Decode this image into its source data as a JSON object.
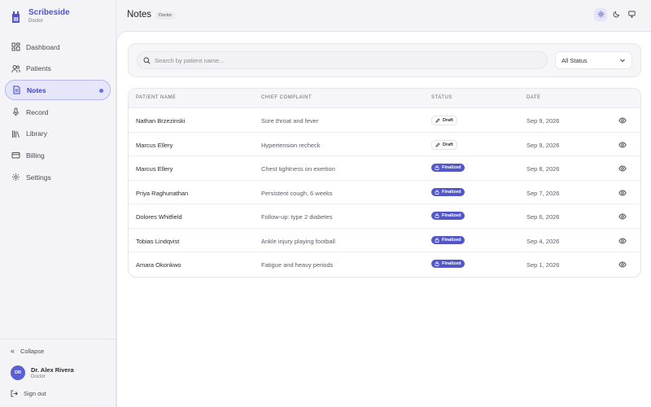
{
  "app": {
    "name": "Scribeside",
    "role": "Doctor"
  },
  "sidebar": {
    "items": [
      {
        "label": "Dashboard",
        "icon": "dashboard-icon"
      },
      {
        "label": "Patients",
        "icon": "users-icon"
      },
      {
        "label": "Notes",
        "icon": "document-icon",
        "active": true
      },
      {
        "label": "Record",
        "icon": "microphone-icon"
      },
      {
        "label": "Library",
        "icon": "library-icon"
      },
      {
        "label": "Billing",
        "icon": "credit-card-icon"
      },
      {
        "label": "Settings",
        "icon": "gear-icon"
      }
    ],
    "collapse_label": "Collapse",
    "user": {
      "initials": "DR",
      "name": "Dr. Alex Rivera",
      "role": "Doctor"
    },
    "signout_label": "Sign out"
  },
  "header": {
    "title": "Notes",
    "badge": "Doctor"
  },
  "filters": {
    "search_placeholder": "Search by patient name...",
    "status_value": "All Status"
  },
  "table": {
    "columns": {
      "patient": "PATIENT NAME",
      "complaint": "CHIEF COMPLAINT",
      "status": "STATUS",
      "date": "DATE"
    },
    "rows": [
      {
        "patient": "Nathan Brzezinski",
        "complaint": "Sore throat and fever",
        "status": "Draft",
        "date": "Sep 9, 2026"
      },
      {
        "patient": "Marcus Ellery",
        "complaint": "Hypertension recheck",
        "status": "Draft",
        "date": "Sep 9, 2026"
      },
      {
        "patient": "Marcus Ellery",
        "complaint": "Chest tightness on exertion",
        "status": "Finalized",
        "date": "Sep 8, 2026"
      },
      {
        "patient": "Priya Raghunathan",
        "complaint": "Persistent cough, 6 weeks",
        "status": "Finalized",
        "date": "Sep 7, 2026"
      },
      {
        "patient": "Dolores Whitfield",
        "complaint": "Follow-up: type 2 diabetes",
        "status": "Finalized",
        "date": "Sep 6, 2026"
      },
      {
        "patient": "Tobias Lindqvist",
        "complaint": "Ankle injury playing football",
        "status": "Finalized",
        "date": "Sep 4, 2026"
      },
      {
        "patient": "Amara Okonkwo",
        "complaint": "Fatigue and heavy periods",
        "status": "Finalized",
        "date": "Sep 1, 2026"
      }
    ]
  },
  "colors": {
    "accent": "#4f54c9",
    "finalized_badge": "#5157c9",
    "active_nav_bg": "#e6e6fb"
  }
}
